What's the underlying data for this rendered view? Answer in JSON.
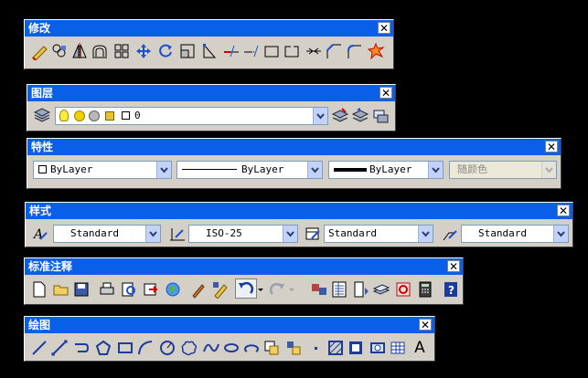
{
  "toolbars": {
    "modify": {
      "title": "修改",
      "close": "✕"
    },
    "layers": {
      "title": "图层",
      "close": "✕",
      "layer_name": "0"
    },
    "properties": {
      "title": "特性",
      "close": "✕",
      "color": "ByLayer",
      "linetype": "ByLayer",
      "lineweight": "ByLayer",
      "plotstyle": "随颜色"
    },
    "styles": {
      "title": "样式",
      "close": "✕",
      "text_style": "Standard",
      "dim_style": "ISO-25",
      "table_style": "Standard",
      "mleader_style": "Standard"
    },
    "standard": {
      "title": "标准注释",
      "close": "✕"
    },
    "draw": {
      "title": "绘图",
      "close": "✕",
      "text_glyph": "A"
    }
  },
  "colors": {
    "title_bar": "#0a5fe8",
    "toolbar_bg": "#d4d0c8",
    "desktop": "#000000"
  }
}
